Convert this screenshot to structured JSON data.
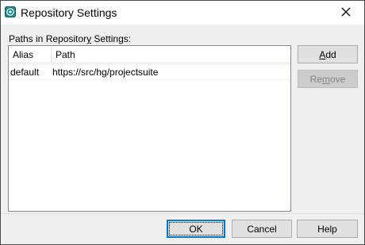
{
  "window": {
    "title": "Repository Settings",
    "icon": "repository-icon",
    "close_icon": "close-icon"
  },
  "paths_section": {
    "label_prefix": "Paths in Repositor",
    "label_underlined": "y",
    "label_suffix": " Settings:"
  },
  "list": {
    "columns": [
      "Alias",
      "Path"
    ],
    "rows": [
      {
        "alias": "default",
        "path": "https://src/hg/projectsuite"
      }
    ]
  },
  "side_buttons": {
    "add_prefix": "",
    "add_underlined": "A",
    "add_suffix": "dd",
    "remove_prefix": "Re",
    "remove_underlined": "m",
    "remove_suffix": "ove",
    "remove_enabled": false
  },
  "footer_buttons": {
    "ok": "OK",
    "cancel": "Cancel",
    "help": "Help"
  },
  "colors": {
    "accent": "#0078d7",
    "icon_teal": "#1a8a8a"
  }
}
